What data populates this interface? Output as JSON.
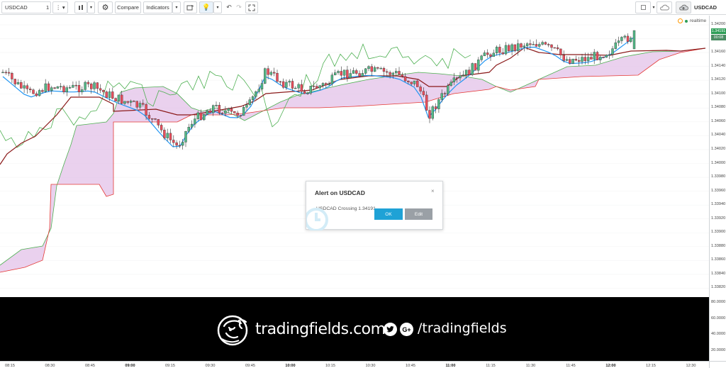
{
  "toolbar": {
    "symbol": "USDCAD",
    "interval": "1",
    "compare_label": "Compare",
    "indicators_label": "Indicators",
    "right_symbol": "USDCAD"
  },
  "chart": {
    "realtime_label": "realtime",
    "price_ticks": [
      "1.34200",
      "1.34180",
      "1.34160",
      "1.34140",
      "1.34120",
      "1.34100",
      "1.34080",
      "1.34060",
      "1.34040",
      "1.34020",
      "1.34000",
      "1.33980",
      "1.33960",
      "1.33940",
      "1.33920",
      "1.33900",
      "1.33880",
      "1.33860",
      "1.33840",
      "1.33820"
    ],
    "last_price": "1.34191",
    "countdown": "00:08",
    "time_ticks": [
      {
        "label": "08:15",
        "bold": false
      },
      {
        "label": "08:30",
        "bold": false
      },
      {
        "label": "08:45",
        "bold": false
      },
      {
        "label": "09:00",
        "bold": true
      },
      {
        "label": "09:15",
        "bold": false
      },
      {
        "label": "09:30",
        "bold": false
      },
      {
        "label": "09:45",
        "bold": false
      },
      {
        "label": "10:00",
        "bold": true
      },
      {
        "label": "10:15",
        "bold": false
      },
      {
        "label": "10:30",
        "bold": false
      },
      {
        "label": "10:45",
        "bold": false
      },
      {
        "label": "11:00",
        "bold": true
      },
      {
        "label": "11:15",
        "bold": false
      },
      {
        "label": "11:30",
        "bold": false
      },
      {
        "label": "11:45",
        "bold": false
      },
      {
        "label": "12:00",
        "bold": true
      },
      {
        "label": "12:15",
        "bold": false
      },
      {
        "label": "12:30",
        "bold": false
      }
    ],
    "lower_ticks": [
      "80.0000",
      "60.0000",
      "40.0000",
      "20.0000"
    ],
    "colors": {
      "up": "#53b987",
      "down": "#eb4d5c",
      "tenkan": "#2196f3",
      "kijun": "#8b1a1a",
      "chikou": "#4caf50",
      "cloud": "#e1bee7",
      "span_a": "#4caf50",
      "span_b": "#e53935",
      "tag_price": "#2e9e57"
    }
  },
  "banner": {
    "brand": "tradingfields.com",
    "twitter_icon": "twitter-icon",
    "gplus_label": "G+",
    "handle": "/tradingfields"
  },
  "dialog": {
    "title": "Alert on USDCAD",
    "close_glyph": "×",
    "message": "USDCAD Crossing 1.34191",
    "ok_label": "OK",
    "edit_label": "Edit"
  }
}
